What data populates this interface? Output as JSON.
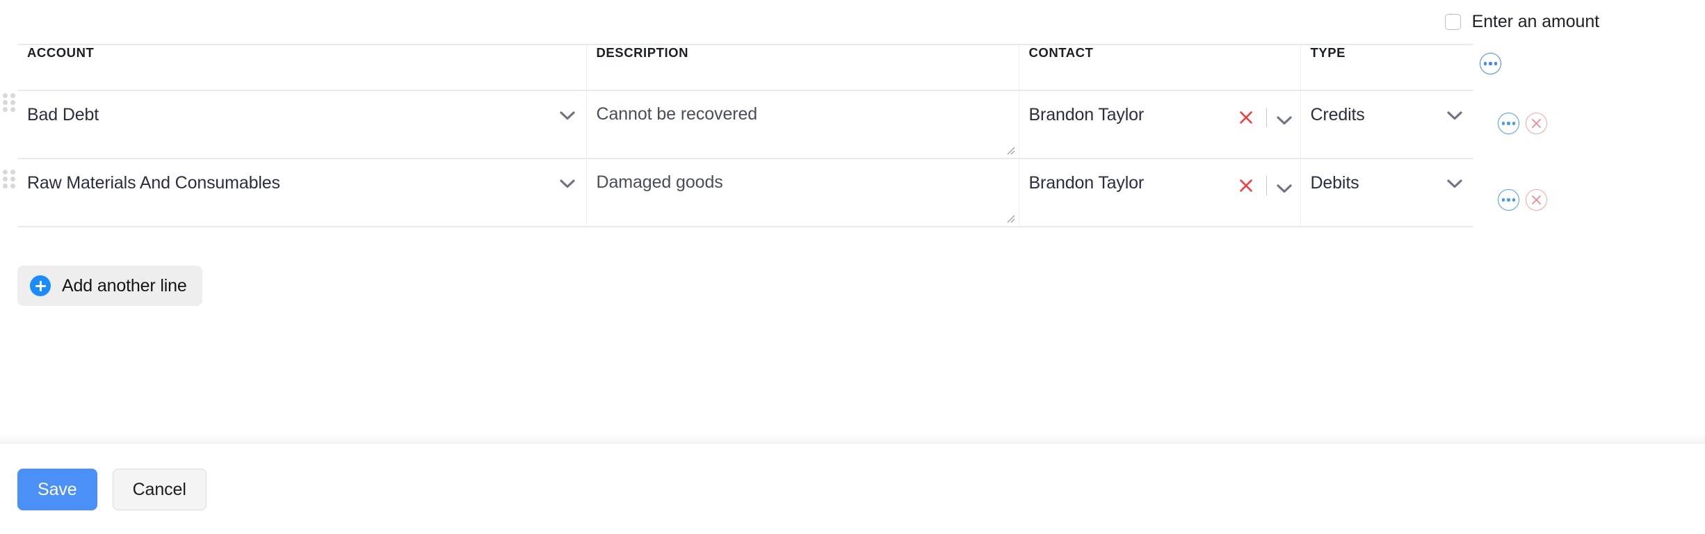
{
  "topbar": {
    "amount_checkbox_label": "Enter an amount",
    "amount_checkbox_checked": false
  },
  "table": {
    "columns": [
      {
        "key": "account",
        "label": "ACCOUNT"
      },
      {
        "key": "description",
        "label": "DESCRIPTION"
      },
      {
        "key": "contact",
        "label": "CONTACT"
      },
      {
        "key": "type",
        "label": "TYPE"
      }
    ],
    "header_menu_icon": "ellipsis-icon",
    "rows": [
      {
        "account": "Bad Debt",
        "description": "Cannot be recovered",
        "contact": "Brandon Taylor",
        "type": "Credits",
        "drag_icon": "drag-handle-icon",
        "menu_icon": "ellipsis-icon",
        "remove_icon": "close-circle-icon",
        "contact_clear_icon": "close-icon",
        "account_caret_icon": "chevron-down-icon",
        "contact_caret_icon": "chevron-down-icon",
        "type_caret_icon": "chevron-down-icon",
        "resize_icon": "resize-grip-icon"
      },
      {
        "account": "Raw Materials And Consumables",
        "description": "Damaged goods",
        "contact": "Brandon Taylor",
        "type": "Debits",
        "drag_icon": "drag-handle-icon",
        "menu_icon": "ellipsis-icon",
        "remove_icon": "close-circle-icon",
        "contact_clear_icon": "close-icon",
        "account_caret_icon": "chevron-down-icon",
        "contact_caret_icon": "chevron-down-icon",
        "type_caret_icon": "chevron-down-icon",
        "resize_icon": "resize-grip-icon"
      }
    ]
  },
  "add_line": {
    "label": "Add another line",
    "icon": "plus-circle-icon"
  },
  "footer": {
    "save_label": "Save",
    "cancel_label": "Cancel"
  },
  "colors": {
    "primary": "#4a90f7",
    "accent_blue": "#4a9bea",
    "danger_red": "#f05050",
    "danger_soft": "#f4a4a4",
    "border": "#e8eaee",
    "add_line_bg": "#eeeeee"
  }
}
